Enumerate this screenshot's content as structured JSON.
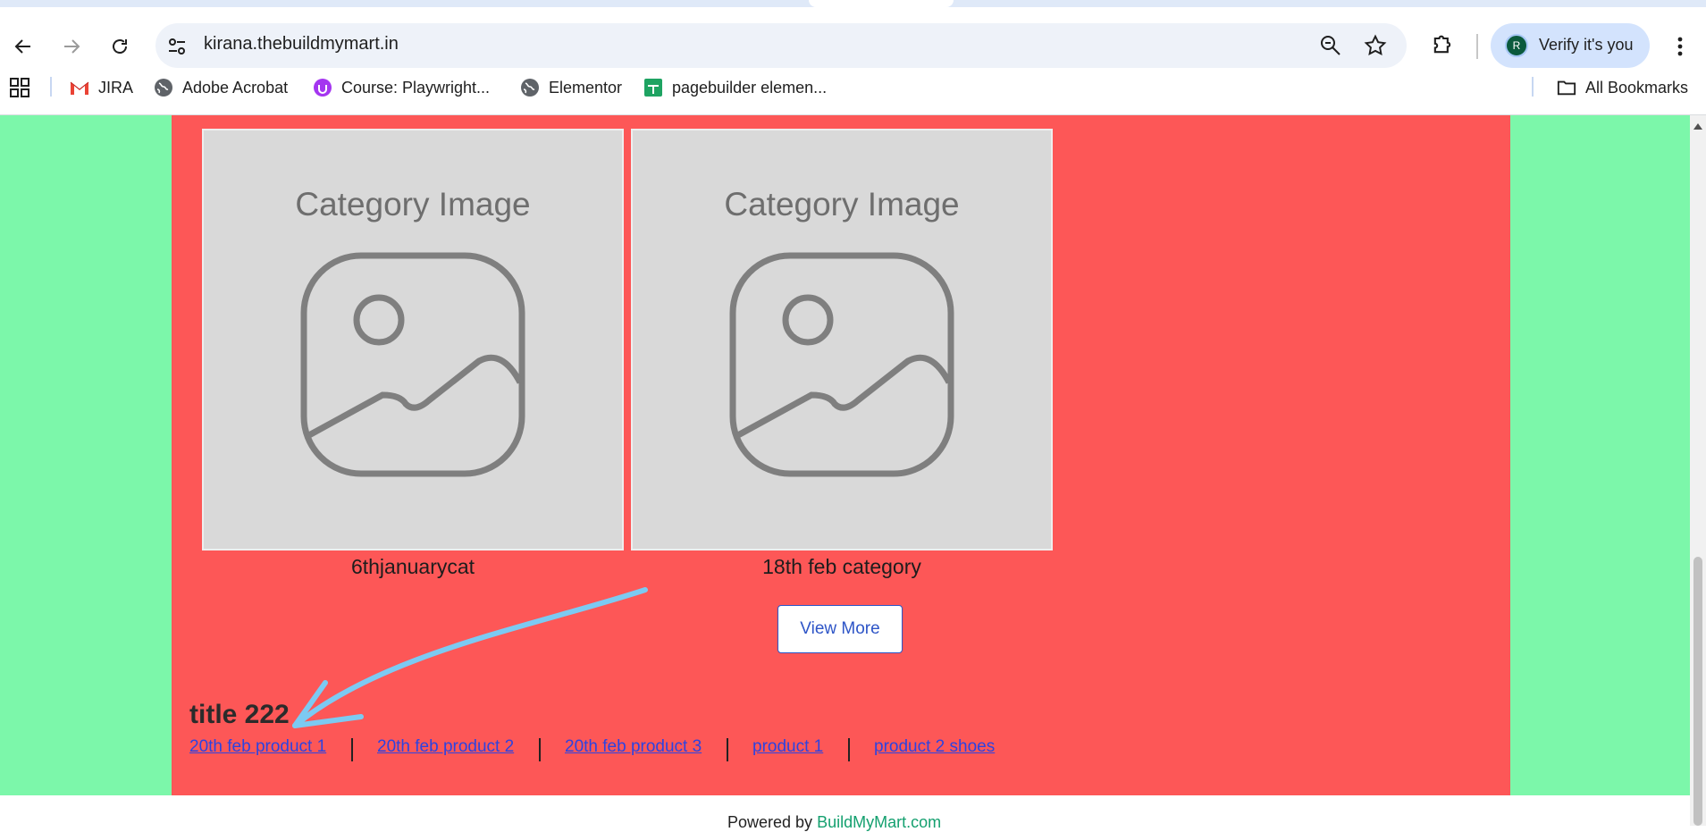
{
  "browser": {
    "url": "kirana.thebuildmymart.in",
    "profile_label": "Verify it's you",
    "profile_initial": "R",
    "bookmarks": [
      {
        "label": "JIRA",
        "icon": "gmail-icon"
      },
      {
        "label": "Adobe Acrobat",
        "icon": "globe-icon"
      },
      {
        "label": "Course: Playwright...",
        "icon": "udemy-icon"
      },
      {
        "label": "Elementor",
        "icon": "globe-icon"
      },
      {
        "label": "pagebuilder elemen...",
        "icon": "sheets-icon"
      }
    ],
    "all_bookmarks": "All Bookmarks"
  },
  "categories": [
    {
      "image_text": "Category Image",
      "name": "6thjanuarycat"
    },
    {
      "image_text": "Category Image",
      "name": "18th feb category"
    }
  ],
  "view_more": "View More",
  "section": {
    "title": "title 222",
    "products": [
      "20th feb product 1",
      "20th feb product 2",
      "20th feb product 3",
      "product 1",
      "product 2 shoes"
    ]
  },
  "footer": {
    "prefix": "Powered by ",
    "brand": "BuildMyMart.com"
  },
  "colors": {
    "outer_bg": "#7cf7aa",
    "panel_bg": "#fd5757",
    "link": "#2d43e0",
    "annotation_arrow": "#7ccaf2"
  }
}
